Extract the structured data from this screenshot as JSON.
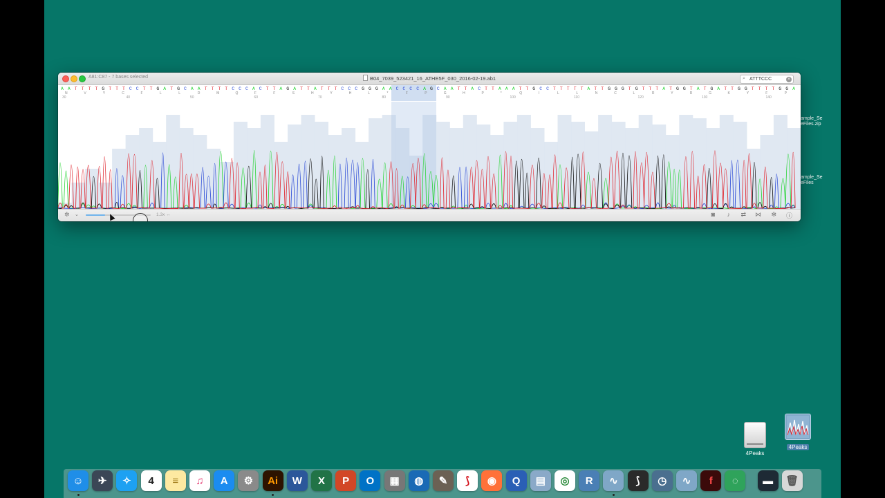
{
  "window": {
    "selection_info": "A81:C87 - 7 bases selected",
    "title": "B04_7039_523421_16_ATHE5F_030_2016-02-19.ab1",
    "search": {
      "value": "ATTTCCC"
    },
    "zoom": "1.3x",
    "colors": {
      "A": "#26d433",
      "C": "#2b4ad6",
      "G": "#111111",
      "T": "#e0262f",
      "selection": "#a9c3e6"
    },
    "bottom_toolbar": [
      "gear-icon",
      "chevron-down-icon",
      "camera-icon",
      "microphone-icon",
      "swap-icon",
      "bowtie-icon",
      "settings-sparkle-icon",
      "info-icon"
    ]
  },
  "sequence": "AATTTTGTTTCCTTGATGCAATTTTCCCACTTAGATTATTTCCCGGGAACCCCAGCAATTACTTAAATTGCCTTTTTATTGGGTGTTTATGGTATGATTGGTTTTGGA",
  "translation": "NVYCFLLDMQFFSHYHL*FPGHP*QILLNCLRYRGKYFP",
  "positions": [
    "30",
    "40",
    "50",
    "60",
    "70",
    "80",
    "90",
    "100",
    "110",
    "120",
    "130",
    "140"
  ],
  "desktop": {
    "right_edge_labels": [
      "ample_Se\neFiles.zip",
      "ample_Se\neFiles"
    ],
    "icons": [
      {
        "name": "4Peaks",
        "kind": "drive"
      },
      {
        "name": "4Peaks",
        "kind": "app"
      }
    ]
  },
  "dock": [
    {
      "name": "Finder",
      "icon": "finder-icon",
      "running": true
    },
    {
      "name": "Launchpad",
      "icon": "rocket-icon",
      "running": false
    },
    {
      "name": "Safari",
      "icon": "compass-icon",
      "running": false
    },
    {
      "name": "Calendar",
      "icon": "calendar-icon",
      "text": "4",
      "running": false
    },
    {
      "name": "Notes",
      "icon": "notes-icon",
      "running": false
    },
    {
      "name": "iTunes",
      "icon": "music-note-icon",
      "running": false
    },
    {
      "name": "App Store",
      "icon": "app-store-icon",
      "running": false
    },
    {
      "name": "System Preferences",
      "icon": "gear-icon",
      "running": false
    },
    {
      "name": "Illustrator",
      "icon": "illustrator-icon",
      "text": "Ai",
      "running": true
    },
    {
      "name": "Word",
      "icon": "word-icon",
      "text": "W",
      "running": false
    },
    {
      "name": "Excel",
      "icon": "excel-icon",
      "text": "X",
      "running": false
    },
    {
      "name": "PowerPoint",
      "icon": "powerpoint-icon",
      "text": "P",
      "running": false
    },
    {
      "name": "Outlook",
      "icon": "outlook-icon",
      "text": "O",
      "running": false
    },
    {
      "name": "Calculator",
      "icon": "calculator-icon",
      "running": false
    },
    {
      "name": "Network Radar",
      "icon": "globe-icon",
      "running": false
    },
    {
      "name": "GIMP",
      "icon": "gimp-icon",
      "running": false
    },
    {
      "name": "Acrobat",
      "icon": "acrobat-icon",
      "running": false
    },
    {
      "name": "Firefox",
      "icon": "firefox-icon",
      "running": false
    },
    {
      "name": "QuickTime",
      "icon": "quicktime-icon",
      "running": false
    },
    {
      "name": "Preview",
      "icon": "preview-icon",
      "running": false
    },
    {
      "name": "Chrome",
      "icon": "chrome-icon",
      "running": false
    },
    {
      "name": "R",
      "icon": "r-icon",
      "text": "R",
      "running": false
    },
    {
      "name": "4Peaks",
      "icon": "chromatogram-icon",
      "running": true
    },
    {
      "name": "Acrobat Reader",
      "icon": "acrobat-reader-icon",
      "running": false
    },
    {
      "name": "Time Machine",
      "icon": "time-machine-icon",
      "running": false
    },
    {
      "name": "4Peaks",
      "icon": "chromatogram-icon",
      "running": false
    },
    {
      "name": "Flash",
      "icon": "flash-icon",
      "text": "f",
      "running": false
    },
    {
      "name": "Snapshot",
      "icon": "lens-icon",
      "running": false
    },
    {
      "name": "Desktop Folder",
      "icon": "folder-icon",
      "running": false
    },
    {
      "name": "Trash",
      "icon": "trash-icon",
      "running": false
    }
  ]
}
